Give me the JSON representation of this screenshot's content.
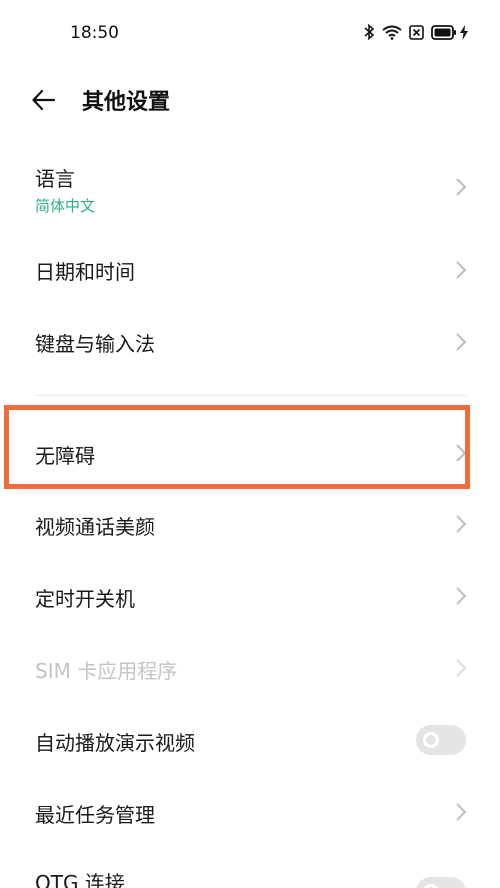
{
  "status_bar": {
    "time": "18:50",
    "icons": [
      "bluetooth-icon",
      "wifi-icon",
      "sim-off-icon",
      "battery-icon",
      "charging-icon"
    ]
  },
  "header": {
    "title": "其他设置",
    "back_icon": "arrow-left-icon"
  },
  "settings": {
    "language": {
      "label": "语言",
      "value": "简体中文"
    },
    "datetime": {
      "label": "日期和时间"
    },
    "keyboard": {
      "label": "键盘与输入法"
    },
    "accessibility": {
      "label": "无障碍"
    },
    "video_beauty": {
      "label": "视频通话美颜"
    },
    "scheduled_power": {
      "label": "定时开关机"
    },
    "sim_apps": {
      "label": "SIM 卡应用程序"
    },
    "autoplay_demo": {
      "label": "自动播放演示视频",
      "enabled": false
    },
    "recent_tasks": {
      "label": "最近任务管理"
    },
    "otg": {
      "label": "OTG 连接",
      "enabled": false
    }
  },
  "colors": {
    "accent_green": "#2fae8a",
    "highlight_orange": "#f26b3a",
    "disabled_text": "#c4c4c4"
  }
}
